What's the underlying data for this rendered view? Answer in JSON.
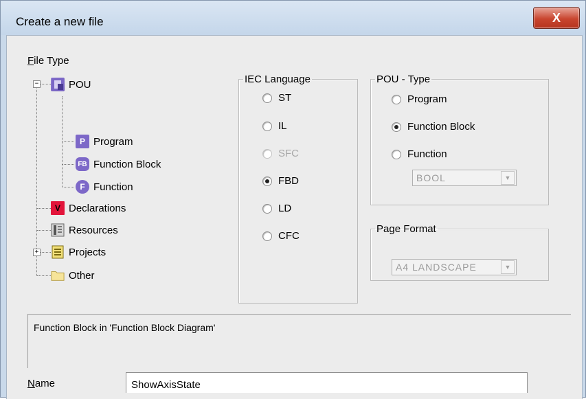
{
  "window": {
    "title": "Create a new file",
    "close_label": "X"
  },
  "file_type": {
    "label_accel": "F",
    "label_rest": "ile Type",
    "tree": [
      {
        "id": "pou",
        "label": "POU",
        "expander": "−",
        "icon_text": ""
      },
      {
        "id": "program",
        "label": "Program",
        "icon_text": "P"
      },
      {
        "id": "function-block",
        "label": "Function Block",
        "icon_text": "FB"
      },
      {
        "id": "function",
        "label": "Function",
        "icon_text": "F"
      },
      {
        "id": "declarations",
        "label": "Declarations",
        "icon_text": "V"
      },
      {
        "id": "resources",
        "label": "Resources",
        "icon_text": ""
      },
      {
        "id": "projects",
        "label": "Projects",
        "expander": "+",
        "icon_text": ""
      },
      {
        "id": "other",
        "label": "Other",
        "icon_text": ""
      }
    ]
  },
  "iec_language": {
    "legend": "IEC Language",
    "options": [
      {
        "label": "ST",
        "selected": false,
        "disabled": false
      },
      {
        "label": "IL",
        "selected": false,
        "disabled": false
      },
      {
        "label": "SFC",
        "selected": false,
        "disabled": true
      },
      {
        "label": "FBD",
        "selected": true,
        "disabled": false
      },
      {
        "label": "LD",
        "selected": false,
        "disabled": false
      },
      {
        "label": "CFC",
        "selected": false,
        "disabled": false
      }
    ]
  },
  "pou_type": {
    "legend": "POU - Type",
    "options": [
      {
        "label": "Program",
        "selected": false
      },
      {
        "label": "Function Block",
        "selected": true
      },
      {
        "label": "Function",
        "selected": false
      }
    ],
    "return_type": "BOOL"
  },
  "page_format": {
    "legend": "Page Format",
    "value": "A4 LANDSCAPE"
  },
  "description": "Function Block in 'Function Block Diagram'",
  "name": {
    "label_accel": "N",
    "label_rest": "ame",
    "value": "ShowAxisState"
  },
  "colors": {
    "title_bar": "#c9d9ea",
    "close_button": "#c9452f",
    "dialog_bg": "#ececec"
  }
}
